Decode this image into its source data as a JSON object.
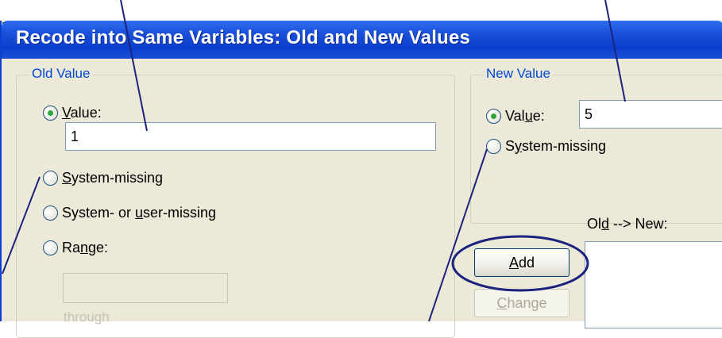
{
  "window": {
    "title": "Recode into Same Variables: Old and New Values"
  },
  "old_value": {
    "legend": "Old Value",
    "value_radio": {
      "label_u": "V",
      "label_rest": "alue:",
      "checked": true
    },
    "value_input": "1",
    "system_missing": {
      "label_u": "S",
      "label_rest": "ystem-missing"
    },
    "system_or_user_missing": {
      "label_pre": "System- or ",
      "label_u": "u",
      "label_rest": "ser-missing"
    },
    "range": {
      "label_pre": "Ra",
      "label_u": "n",
      "label_rest": "ge:"
    },
    "range_input": "",
    "through_label": "through"
  },
  "new_value": {
    "legend": "New Value",
    "value_radio": {
      "label_pre": "Val",
      "label_u": "u",
      "label_rest": "e:",
      "checked": true
    },
    "value_input": "5",
    "system_missing": {
      "label_pre": "S",
      "label_u": "y",
      "label_rest": "stem-missing"
    }
  },
  "old_new": {
    "label_pre": "Ol",
    "label_u": "d",
    "label_rest": " --> New:"
  },
  "buttons": {
    "add_u": "A",
    "add_rest": "dd",
    "change_u": "C",
    "change_rest": "hange"
  },
  "colors": {
    "title_bar": "#0c3ecd",
    "dialog_bg": "#ece9d8",
    "legend_text": "#0046d5",
    "annotation": "#1a237e",
    "radio_check": "#2ea43a"
  }
}
